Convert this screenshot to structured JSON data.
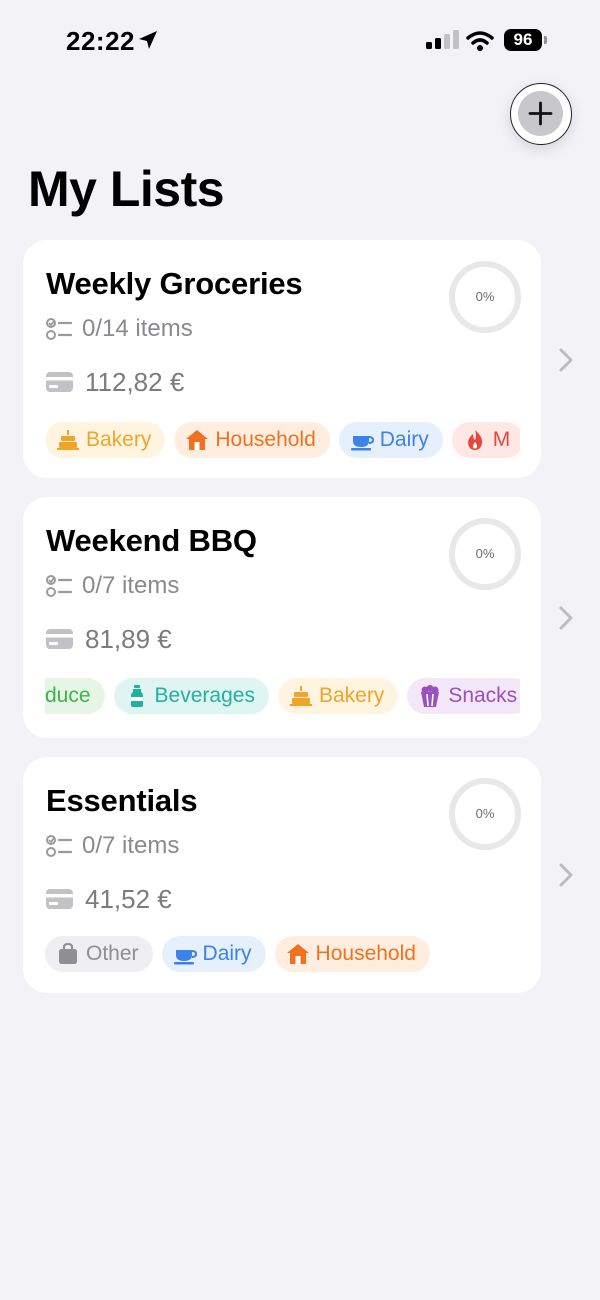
{
  "status_bar": {
    "time": "22:22",
    "battery": "96"
  },
  "header": {
    "title": "My Lists"
  },
  "colors": {
    "bakery": "#f0a52a",
    "household": "#f0721f",
    "dairy": "#3c82e8",
    "meat": "#e8473c",
    "produce": "#3cb54a",
    "beverages": "#22b0a0",
    "snacks": "#9b4fc0",
    "other": "#8e8e93"
  },
  "lists": [
    {
      "title": "Weekly Groceries",
      "items": "0/14 items",
      "price": "112,82 €",
      "progress": "0%",
      "tags": [
        {
          "label": "Bakery",
          "icon": "cake-icon",
          "color": "#f0a52a",
          "bg": "#fff4e0"
        },
        {
          "label": "Household",
          "icon": "house-icon",
          "color": "#f0721f",
          "bg": "#ffede0"
        },
        {
          "label": "Dairy",
          "icon": "cup-icon",
          "color": "#3c82e8",
          "bg": "#e6effc"
        },
        {
          "label": "M",
          "icon": "flame-icon",
          "color": "#e8473c",
          "bg": "#fde8e6"
        }
      ]
    },
    {
      "title": "Weekend BBQ",
      "items": "0/7 items",
      "price": "81,89 €",
      "progress": "0%",
      "tags": [
        {
          "label": "duce",
          "icon": "",
          "color": "#3cb54a",
          "bg": "#e6f5e6"
        },
        {
          "label": "Beverages",
          "icon": "bottle-icon",
          "color": "#22b0a0",
          "bg": "#dff5f1"
        },
        {
          "label": "Bakery",
          "icon": "cake-icon",
          "color": "#f0a52a",
          "bg": "#fff4e0"
        },
        {
          "label": "Snacks",
          "icon": "popcorn-icon",
          "color": "#9b4fc0",
          "bg": "#f3e8f8"
        }
      ]
    },
    {
      "title": "Essentials",
      "items": "0/7 items",
      "price": "41,52 €",
      "progress": "0%",
      "tags": [
        {
          "label": "Other",
          "icon": "bag-icon",
          "color": "#8e8e93",
          "bg": "#efeff2"
        },
        {
          "label": "Dairy",
          "icon": "cup-icon",
          "color": "#3c82e8",
          "bg": "#e6effc"
        },
        {
          "label": "Household",
          "icon": "house-icon",
          "color": "#f0721f",
          "bg": "#ffede0"
        }
      ]
    }
  ]
}
